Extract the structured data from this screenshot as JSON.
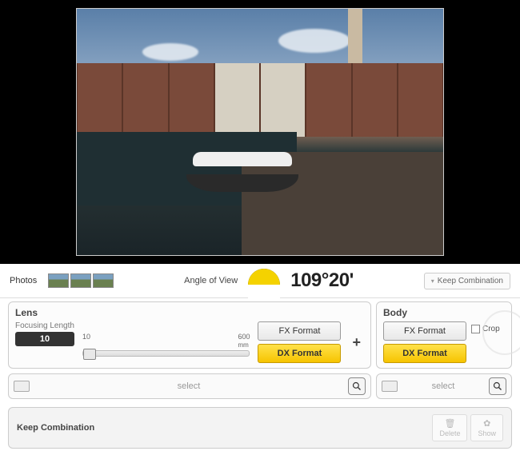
{
  "photos_label": "Photos",
  "angle_of_view": {
    "label": "Angle of View",
    "value": "109°20'"
  },
  "keep_combination_button": "Keep Combination",
  "lens": {
    "title": "Lens",
    "focusing_length_label": "Focusing Length",
    "focusing_length_value": "10",
    "slider_min": "10",
    "slider_max": "600",
    "slider_unit": "mm",
    "fx_label": "FX Format",
    "dx_label": "DX Format",
    "select_label": "select"
  },
  "body": {
    "title": "Body",
    "fx_label": "FX Format",
    "dx_label": "DX Format",
    "crop_label": "Crop",
    "select_label": "select"
  },
  "plus": "+",
  "keep_panel": {
    "title": "Keep Combination",
    "delete_label": "Delete",
    "show_label": "Show"
  }
}
